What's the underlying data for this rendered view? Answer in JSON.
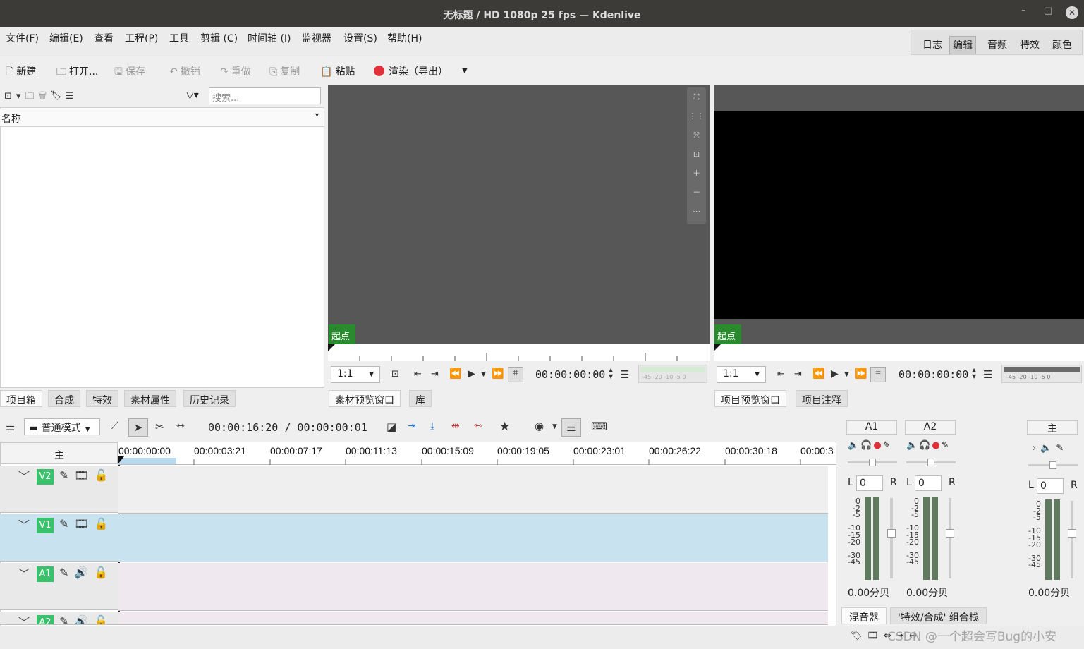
{
  "window": {
    "title": "无标题 / HD 1080p 25 fps — Kdenlive",
    "minimize": "–",
    "maximize": "□",
    "close": "✕"
  },
  "menu": [
    "文件(F)",
    "编辑(E)",
    "查看",
    "工程(P)",
    "工具",
    "剪辑 (C)",
    "时间轴 (I)",
    "监视器",
    "设置(S)",
    "帮助(H)"
  ],
  "workspaces": [
    "日志",
    "编辑",
    "音频",
    "特效",
    "颜色"
  ],
  "workspace_active": "编辑",
  "toolbar": {
    "new": "新建",
    "open": "打开...",
    "save": "保存",
    "undo": "撤销",
    "redo": "重做",
    "copy": "复制",
    "paste": "粘贴",
    "render": "渲染（导出）"
  },
  "bin": {
    "search_placeholder": "搜索...",
    "column_name": "名称"
  },
  "left_tabs": [
    "项目箱",
    "合成",
    "特效",
    "素材属性",
    "历史记录"
  ],
  "clip_monitor": {
    "start_label": "起点",
    "zoom": "1:1",
    "timecode": "00:00:00:00",
    "meter_labels": "-45 -20 -10 -5 0"
  },
  "project_monitor": {
    "start_label": "起点",
    "zoom": "1:1",
    "timecode": "00:00:00:00",
    "meter_labels": "-45 -20 -10 -5 0"
  },
  "mid_tabs": [
    "素材预览窗口",
    "库"
  ],
  "right_tabs": [
    "项目预览窗口",
    "项目注释"
  ],
  "timeline": {
    "mode": "普通模式",
    "position": "00:00:16:20 / 00:00:00:01",
    "master_label": "主",
    "ruler": [
      "00:00:00:00",
      "00:00:03:21",
      "00:00:07:17",
      "00:00:11:13",
      "00:00:15:09",
      "00:00:19:05",
      "00:00:23:01",
      "00:00:26:22",
      "00:00:30:18",
      "00:00:3"
    ],
    "tracks": [
      "V2",
      "V1",
      "A1",
      "A2"
    ]
  },
  "mixer": {
    "channels": [
      "A1",
      "A2",
      "主"
    ],
    "balance_l": "L",
    "balance_r": "R",
    "balance_value": "0",
    "scale": "0\n-2\n-5\n\n-10\n-15\n-20\n\n-30\n-45",
    "gain": "0.00分贝"
  },
  "bottom_tabs": [
    "混音器",
    "'特效/合成' 组合栈"
  ],
  "watermark": "CSDN @一个超会写Bug的小安",
  "colors": {
    "accent_green": "#39c16b",
    "start_badge": "#2a8a2e",
    "v1_track": "#c9e2ef",
    "audio_track": "#efe8ef",
    "record": "#e0303a"
  }
}
